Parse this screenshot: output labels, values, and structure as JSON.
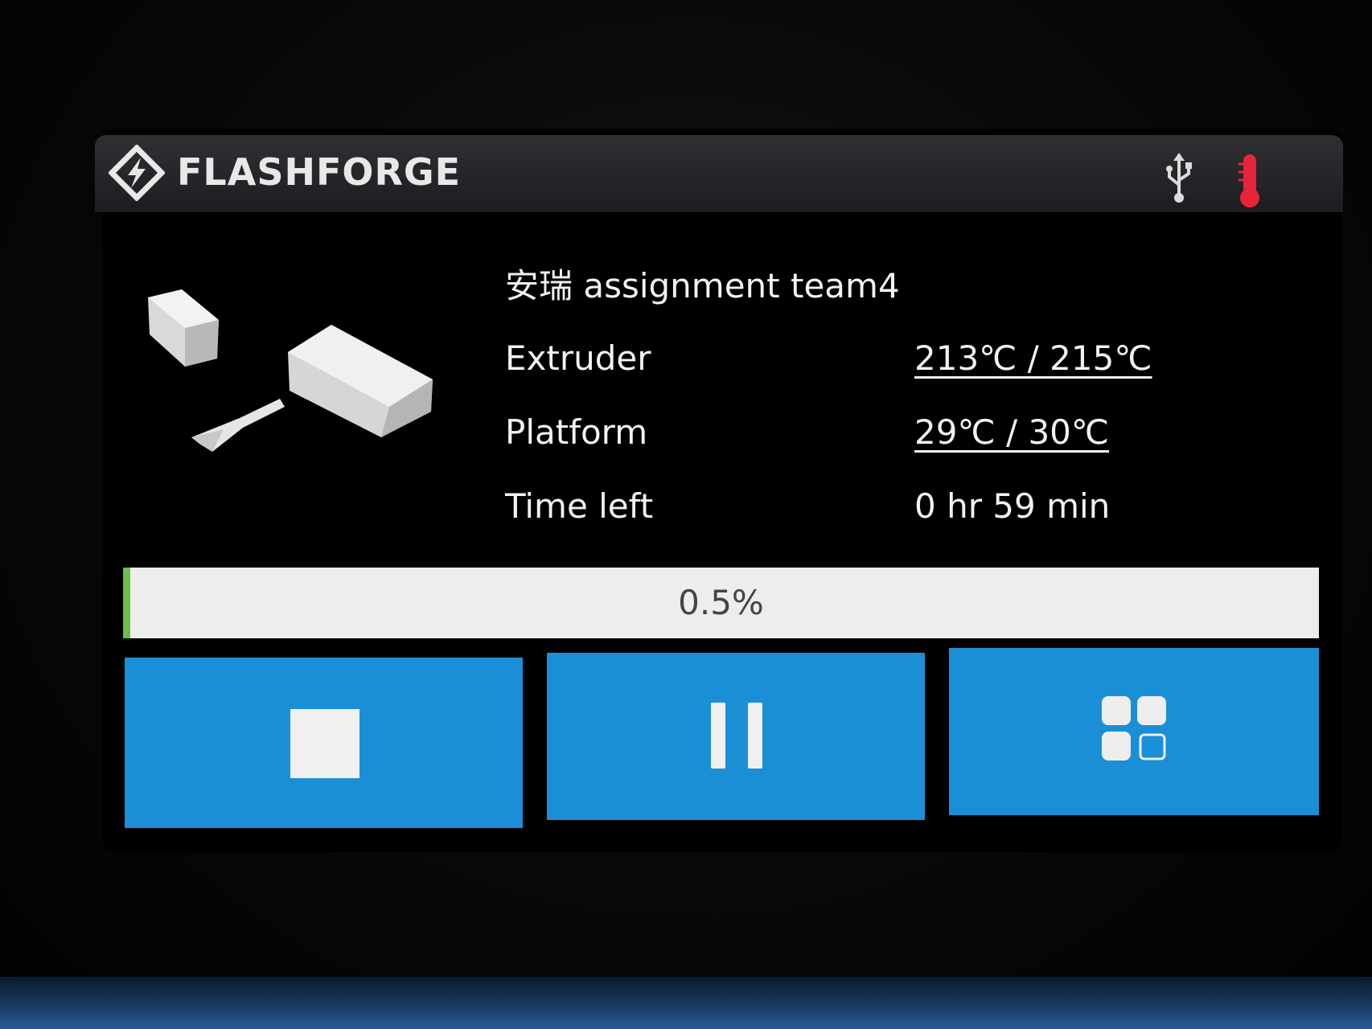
{
  "header": {
    "brand": "FLASHFORGE",
    "icons": [
      "flashforge-logo-icon",
      "usb-icon",
      "thermometer-icon"
    ],
    "thermometer_color": "#e8243a"
  },
  "job": {
    "name": "安瑞 assignment team4"
  },
  "info": [
    {
      "label": "Extruder",
      "value": "213℃ / 215℃"
    },
    {
      "label": "Platform",
      "value": "29℃ / 30℃"
    },
    {
      "label": "Time left",
      "value": "0 hr 59 min"
    }
  ],
  "progress": {
    "label": "0.5%",
    "fraction": 0.005,
    "fill_color": "#6cc04a"
  },
  "buttons": {
    "stop_icon": "stop-icon",
    "pause_icon": "pause-icon",
    "more_icon": "grid-menu-icon",
    "color": "#1b8fd6"
  }
}
